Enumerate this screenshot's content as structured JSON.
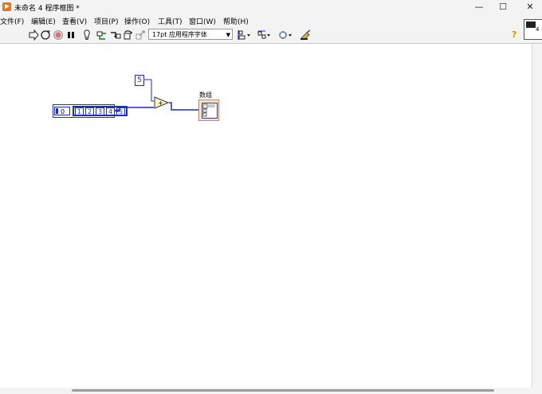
{
  "window": {
    "title": "未命名 4 程序框图 *",
    "min_glyph": "—",
    "max_glyph": "☐",
    "close_glyph": "✕"
  },
  "menu": [
    "文件(F)",
    "编辑(E)",
    "查看(V)",
    "项目(P)",
    "操作(O)",
    "工具(T)",
    "窗口(W)",
    "帮助(H)"
  ],
  "toolbar": {
    "font": "17pt 应用程序字体",
    "help": "?"
  },
  "vi_icon": {
    "number": "4"
  },
  "diagram": {
    "numeric_constant": "5",
    "array_index": "0",
    "array_elements": [
      "1",
      "2",
      "3",
      "4",
      "5"
    ],
    "add_symbol": "+",
    "indicator_label": "数组"
  },
  "colors": {
    "wire": "#1a2bd0",
    "indicator_border": "#e8822b",
    "indicator_fill": "#fde3c8",
    "app_icon": "#e8731a"
  }
}
